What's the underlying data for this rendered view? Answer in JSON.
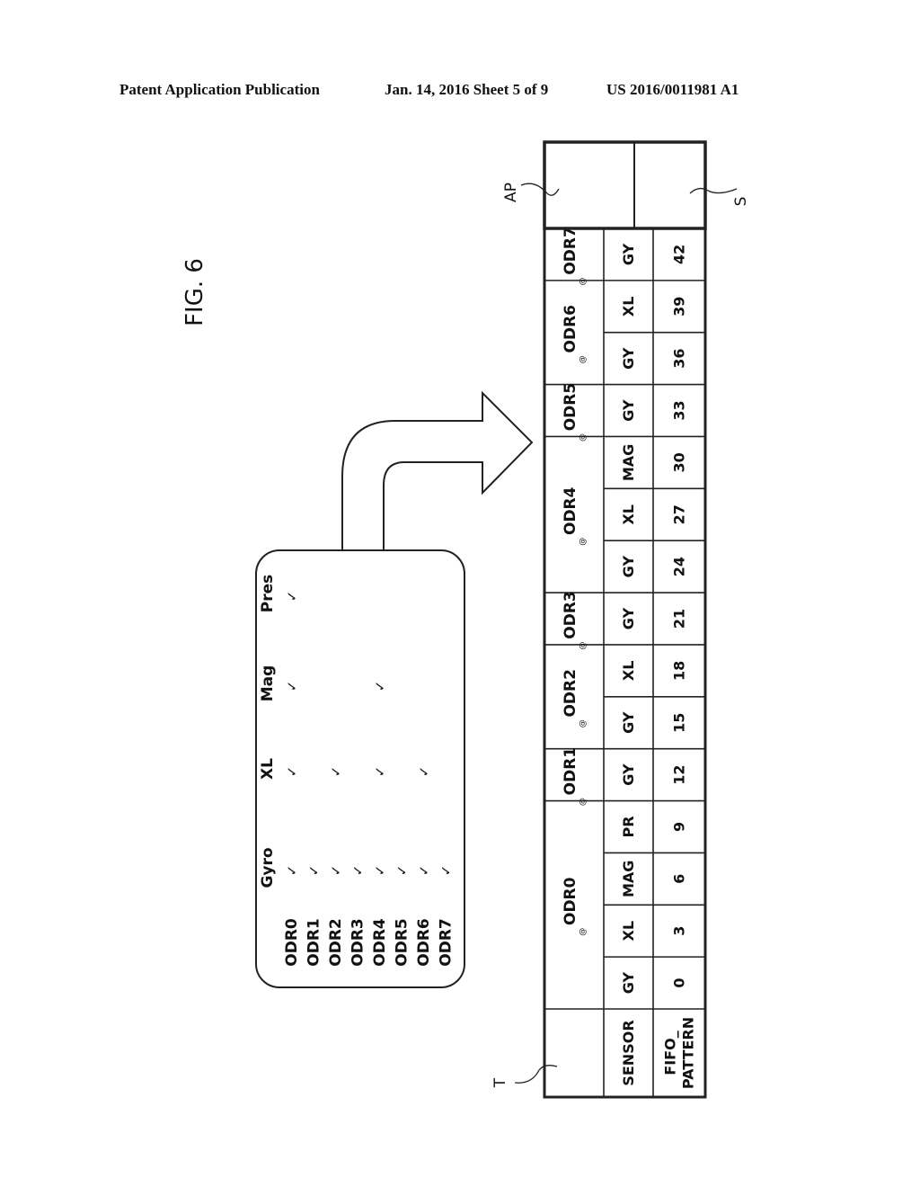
{
  "header": {
    "publication": "Patent Application Publication",
    "date_sheet": "Jan. 14, 2016   Sheet 5 of 9",
    "patent_number": "US 2016/0011981 A1"
  },
  "figure": {
    "label": "FIG. 6",
    "config_box": {
      "columns": [
        "Gyro",
        "XL",
        "Mag",
        "Pres"
      ],
      "rows": [
        {
          "name": "ODR0",
          "checks": [
            true,
            true,
            true,
            true
          ]
        },
        {
          "name": "ODR1",
          "checks": [
            true,
            false,
            false,
            false
          ]
        },
        {
          "name": "ODR2",
          "checks": [
            true,
            true,
            false,
            false
          ]
        },
        {
          "name": "ODR3",
          "checks": [
            true,
            false,
            false,
            false
          ]
        },
        {
          "name": "ODR4",
          "checks": [
            true,
            true,
            true,
            false
          ]
        },
        {
          "name": "ODR5",
          "checks": [
            true,
            false,
            false,
            false
          ]
        },
        {
          "name": "ODR6",
          "checks": [
            true,
            true,
            false,
            false
          ]
        },
        {
          "name": "ODR7",
          "checks": [
            true,
            false,
            false,
            false
          ]
        }
      ],
      "check_glyph": "✓"
    },
    "table": {
      "row_labels": {
        "sensor": "SENSOR",
        "fifo_line1": "FIFO_",
        "fifo_line2": "PATTERN"
      },
      "at_symbol": "@",
      "groups": [
        {
          "odr": "ODR0",
          "sensors": [
            "GY",
            "XL",
            "MAG",
            "PR"
          ],
          "patterns": [
            "0",
            "3",
            "6",
            "9"
          ]
        },
        {
          "odr": "ODR1",
          "sensors": [
            "GY"
          ],
          "patterns": [
            "12"
          ]
        },
        {
          "odr": "ODR2",
          "sensors": [
            "GY",
            "XL"
          ],
          "patterns": [
            "15",
            "18"
          ]
        },
        {
          "odr": "ODR3",
          "sensors": [
            "GY"
          ],
          "patterns": [
            "21"
          ]
        },
        {
          "odr": "ODR4",
          "sensors": [
            "GY",
            "XL",
            "MAG"
          ],
          "patterns": [
            "24",
            "27",
            "30"
          ]
        },
        {
          "odr": "ODR5",
          "sensors": [
            "GY"
          ],
          "patterns": [
            "33"
          ]
        },
        {
          "odr": "ODR6",
          "sensors": [
            "GY",
            "XL"
          ],
          "patterns": [
            "36",
            "39"
          ]
        },
        {
          "odr": "ODR7",
          "sensors": [
            "GY"
          ],
          "patterns": [
            "42"
          ]
        }
      ]
    },
    "reference_labels": {
      "table": "T",
      "ap": "AP",
      "s": "S"
    }
  }
}
